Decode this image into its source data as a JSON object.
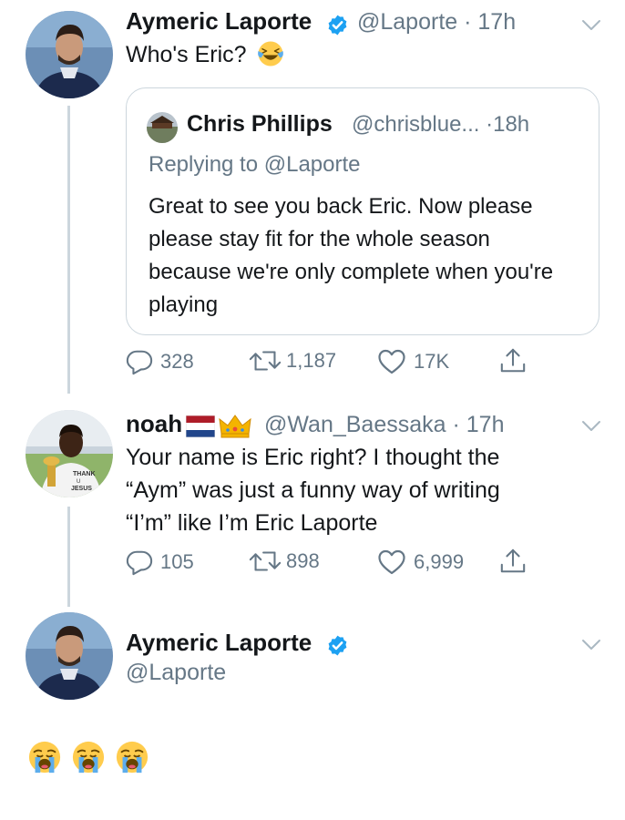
{
  "tweet1": {
    "name": "Aymeric Laporte",
    "handle": "@Laporte",
    "time": "17h",
    "text": "Who's Eric?",
    "quote": {
      "name": "Chris Phillips",
      "handle": "@chrisblue...",
      "time": "18h",
      "reply_context": "Replying to @Laporte",
      "text": "Great to see you back Eric. Now please please stay fit for the whole season because we're only complete when you're playing"
    },
    "replies": "328",
    "retweets": "1,187",
    "likes": "17K"
  },
  "tweet2": {
    "name": "noah",
    "handle": "@Wan_Baessaka",
    "time": "17h",
    "text_line1": "Your name is Eric right? I thought the",
    "text_line2": "“Aym” was just a funny way of writing",
    "text_line3": "“I’m” like I’m Eric Laporte",
    "avatar_shirt_text_1": "THANK",
    "avatar_shirt_text_2": "U",
    "avatar_shirt_text_3": "JESUS",
    "replies": "105",
    "retweets": "898",
    "likes": "6,999"
  },
  "tweet3": {
    "name": "Aymeric Laporte",
    "handle": "@Laporte"
  },
  "colors": {
    "verified": "#1da1f2",
    "secondary": "#657786",
    "border": "#ccd6dd"
  },
  "icons": [
    "verified-badge-icon",
    "laughing-crying-emoji-icon",
    "reply-icon",
    "retweet-icon",
    "like-icon",
    "share-icon",
    "chevron-down-icon",
    "netherlands-flag-icon",
    "crown-icon",
    "loudly-crying-emoji-icon"
  ]
}
